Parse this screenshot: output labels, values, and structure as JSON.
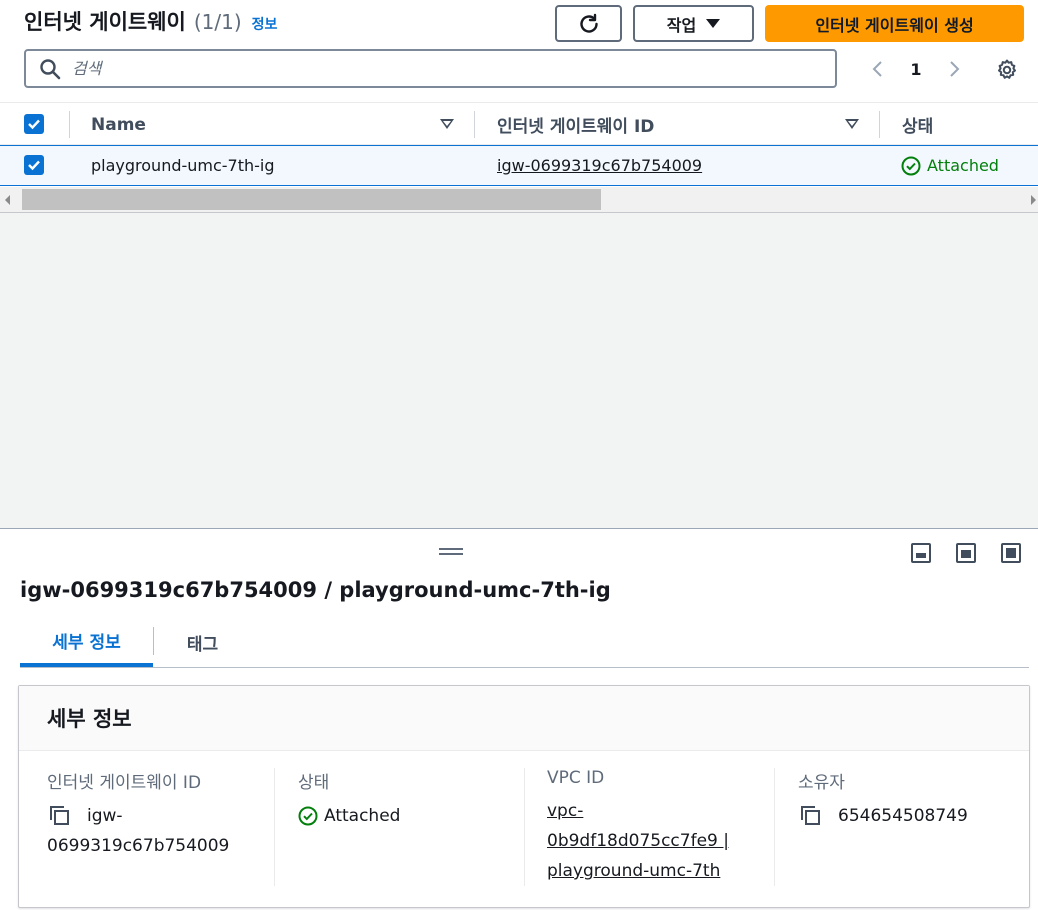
{
  "header": {
    "title": "인터넷 게이트웨이",
    "count": "(1/1)",
    "info": "정보",
    "actions_label": "작업",
    "create_label": "인터넷 게이트웨이 생성"
  },
  "search": {
    "placeholder": "검색"
  },
  "pagination": {
    "current_page": "1"
  },
  "table": {
    "columns": [
      "Name",
      "인터넷 게이트웨이 ID",
      "상태"
    ],
    "rows": [
      {
        "name": "playground-umc-7th-ig",
        "id": "igw-0699319c67b754009",
        "status": "Attached",
        "selected": true
      }
    ]
  },
  "details": {
    "title": "igw-0699319c67b754009 / playground-umc-7th-ig",
    "tabs": [
      "세부 정보",
      "태그"
    ],
    "section_title": "세부 정보",
    "fields": {
      "igw": {
        "label": "인터넷 게이트웨이 ID",
        "value_line1": "igw-",
        "value_line2": "0699319c67b754009"
      },
      "state": {
        "label": "상태",
        "value": "Attached"
      },
      "vpc": {
        "label": "VPC ID",
        "line1": "vpc-",
        "line2": "0b9df18d075cc7fe9 |",
        "line3": "playground-umc-7th"
      },
      "owner": {
        "label": "소유자",
        "value": "654654508749"
      }
    }
  },
  "colors": {
    "accent": "#0972d3",
    "primary_button": "#ff9900",
    "success": "#037f0c"
  }
}
